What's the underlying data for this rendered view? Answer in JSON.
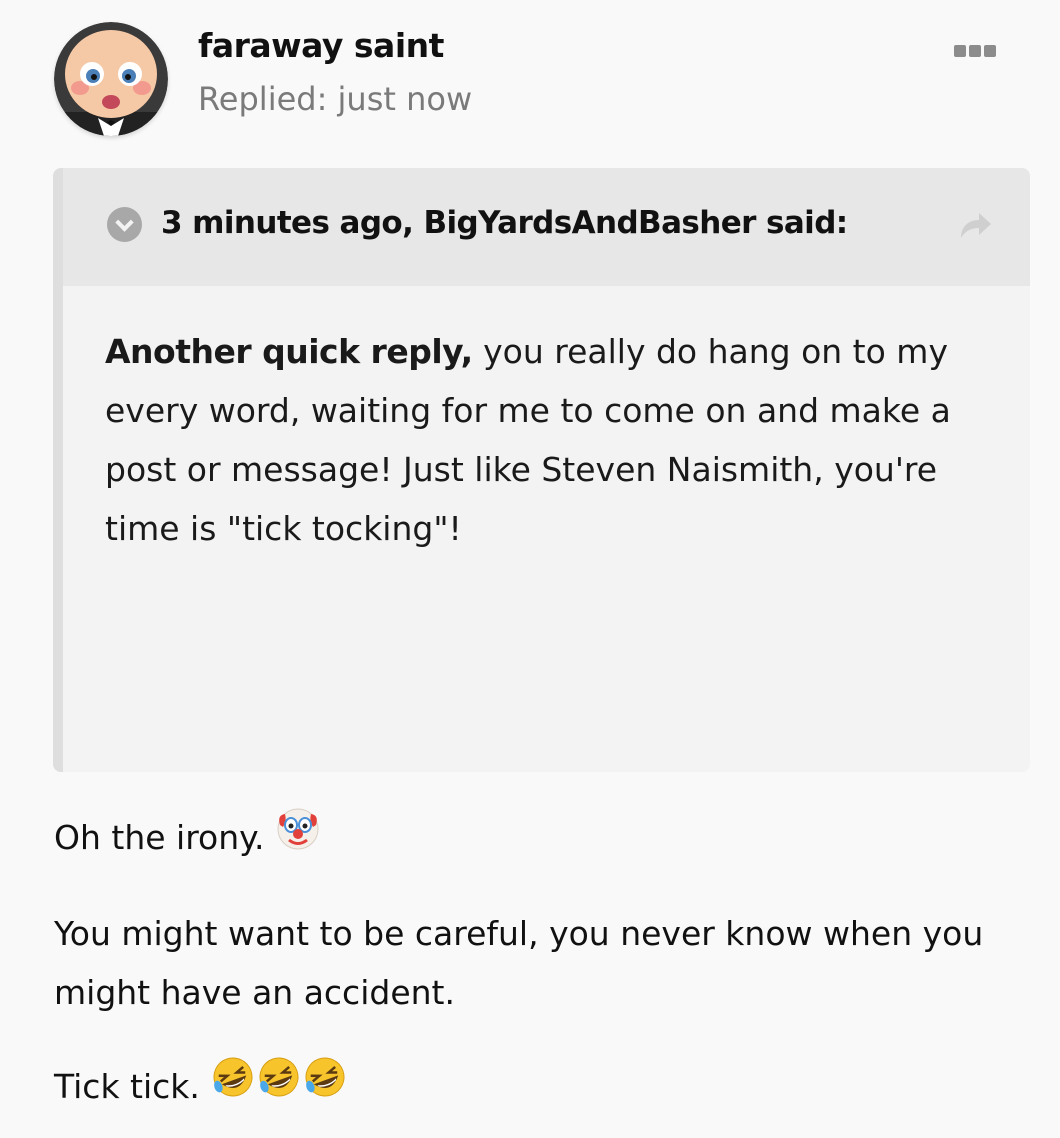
{
  "author": {
    "name": "faraway saint",
    "reply_time": "Replied: just now",
    "avatar": "boss-baby-avatar"
  },
  "menu": {
    "icon": "ellipsis-icon"
  },
  "quote": {
    "citation": "3 minutes ago, BigYardsAndBasher said:",
    "toggle_icon": "chevron-down-circle-icon",
    "share_icon": "share-arrow-icon",
    "body_bold": "Another quick reply,",
    "body_text": " you really do hang on to my every word, waiting for me to come on and make a post or message!  Just like Steven Naismith, you're time is \"tick tocking\"!"
  },
  "content": {
    "p1_text": "Oh the irony. ",
    "p1_emoji": "clown-face-emoji",
    "p2_text": "You might want to be careful, you never know when you might have an accident.",
    "p3_text": "Tick tick. ",
    "p3_emoji": "rolling-on-floor-laughing-emoji"
  },
  "colors": {
    "background": "#f9f9f9",
    "quote_bg": "#f3f3f3",
    "quote_header_bg": "#e7e7e7",
    "quote_border": "#dedede",
    "muted_text": "#7a7a7a"
  }
}
